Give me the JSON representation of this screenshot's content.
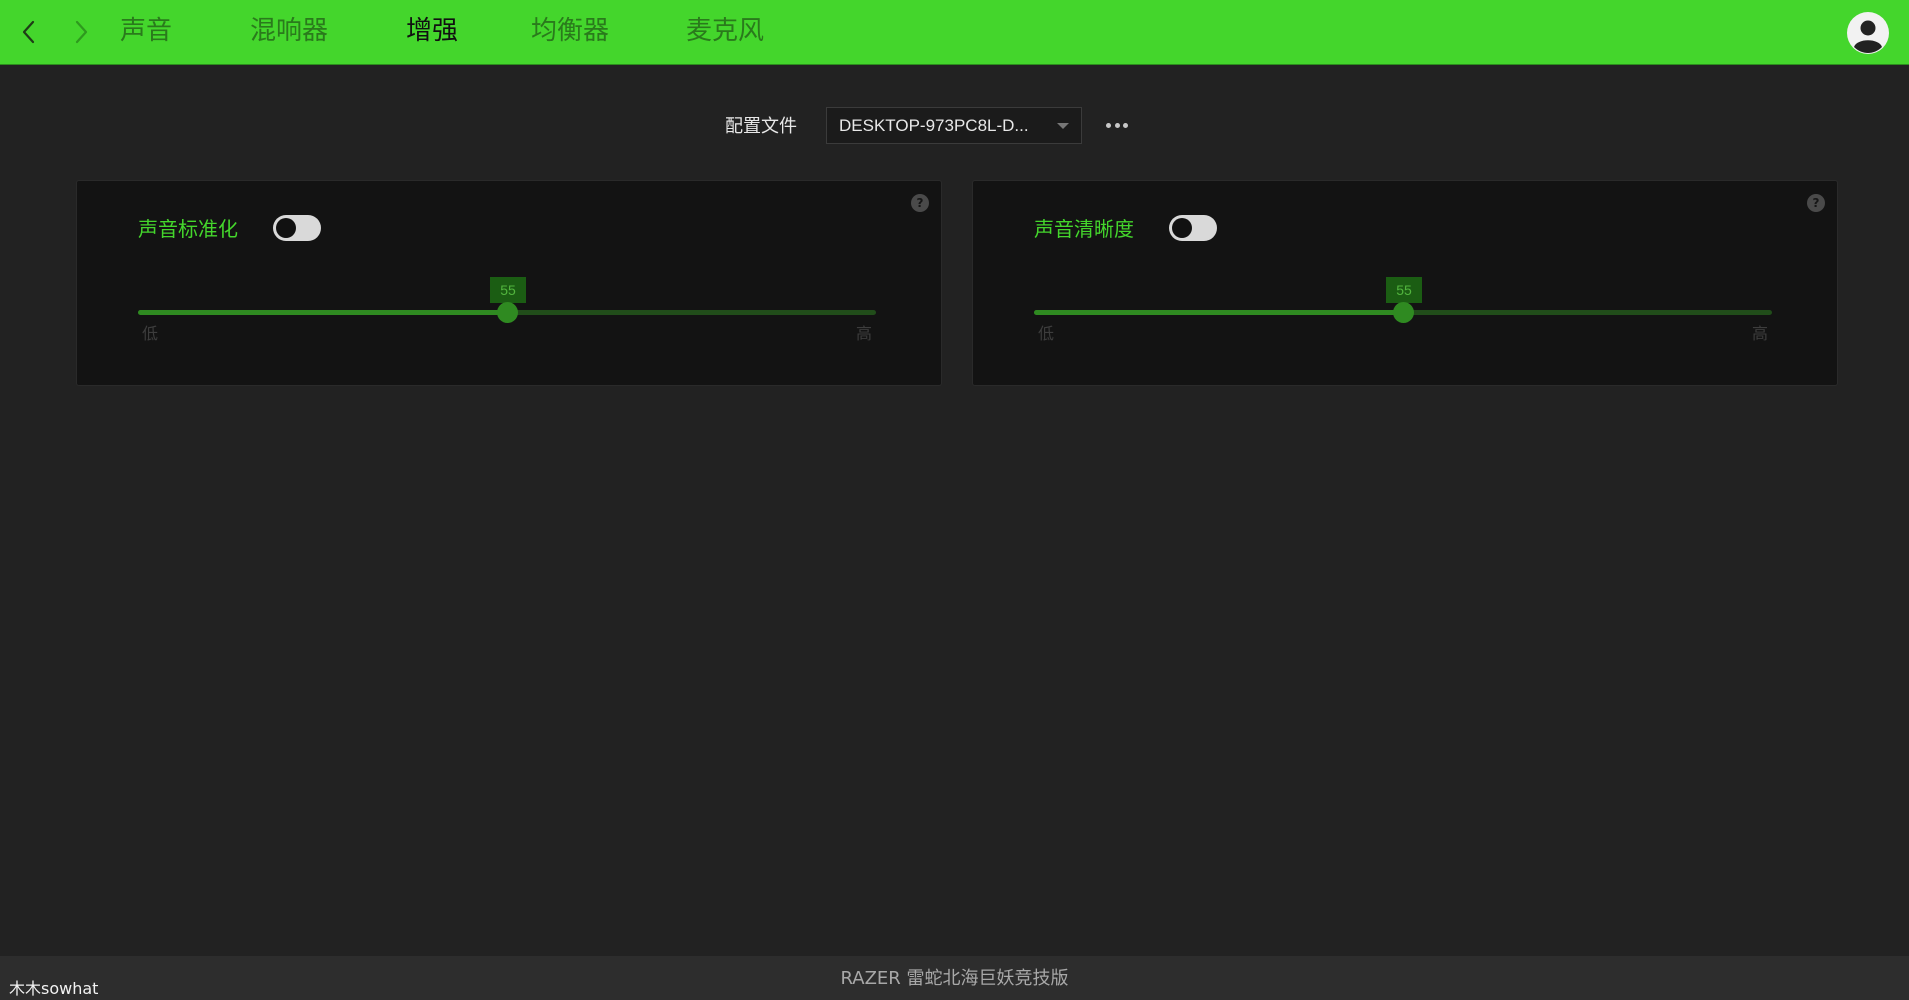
{
  "nav": {
    "back_icon": "chevron-left-icon",
    "forward_icon": "chevron-right-icon",
    "tabs": [
      {
        "label": "声音",
        "active": false
      },
      {
        "label": "混响器",
        "active": false
      },
      {
        "label": "增强",
        "active": true
      },
      {
        "label": "均衡器",
        "active": false
      },
      {
        "label": "麦克风",
        "active": false
      }
    ],
    "avatar_icon": "user-avatar-icon"
  },
  "profile": {
    "label": "配置文件",
    "selected": "DESKTOP-973PC8L-D...",
    "more_icon": "more-options-icon"
  },
  "panels": [
    {
      "title": "声音标准化",
      "enabled": false,
      "help": "?",
      "slider": {
        "value": 55,
        "value_label": "55",
        "min_label": "低",
        "max_label": "高",
        "fraction": 0.5
      }
    },
    {
      "title": "声音清晰度",
      "enabled": false,
      "help": "?",
      "slider": {
        "value": 55,
        "value_label": "55",
        "min_label": "低",
        "max_label": "高",
        "fraction": 0.5
      }
    }
  ],
  "footer": {
    "watermark": "木木sowhat",
    "device": "RAZER 雷蛇北海巨妖竞技版"
  },
  "colors": {
    "accent": "#44d62c",
    "background": "#222222",
    "panel": "#131313",
    "active_tab": "#111111",
    "inactive_tab": "#2a7a1c"
  }
}
